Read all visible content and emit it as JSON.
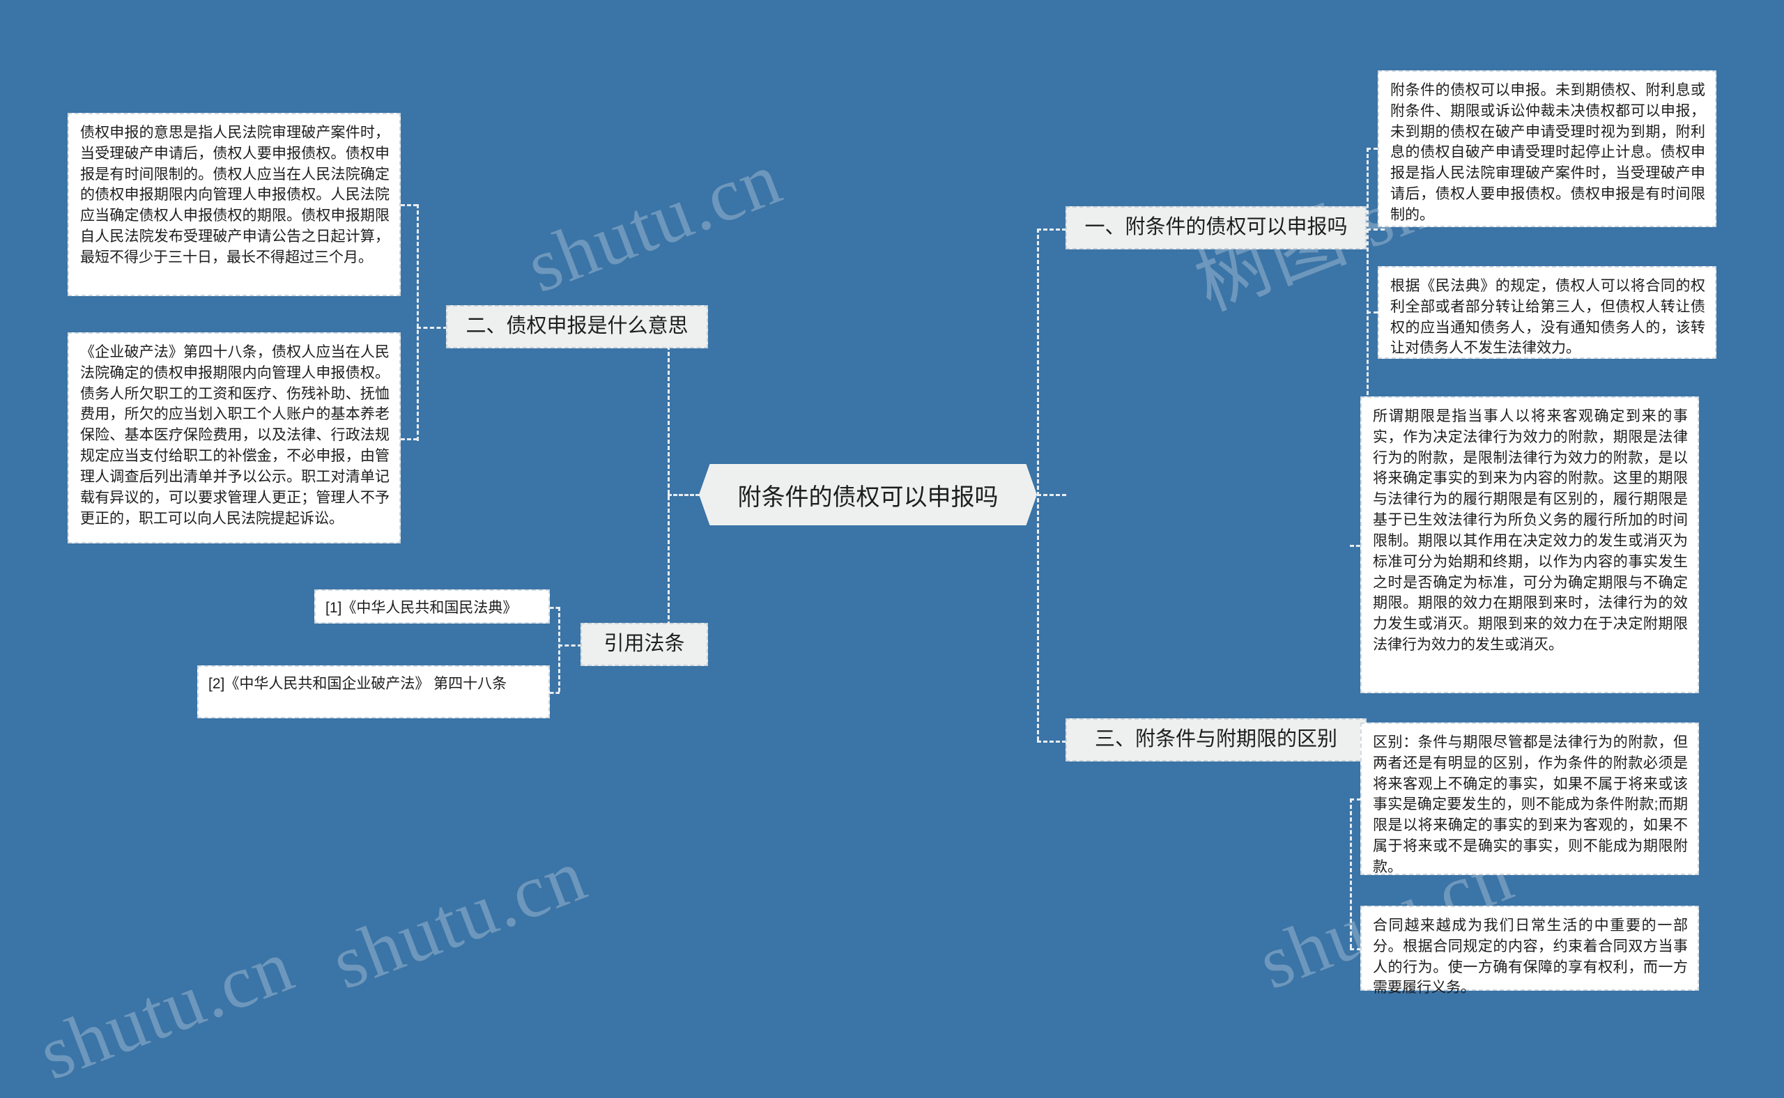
{
  "background_color": "#3b74a6",
  "watermarks": [
    "shutu.cn",
    "树图 shutu.cn",
    "shutu.cn",
    "shutu.cn",
    "shutu.cn"
  ],
  "root": {
    "label": "附条件的债权可以申报吗"
  },
  "branches": {
    "left": [
      {
        "label": "二、债权申报是什么意思",
        "children": [
          "债权申报的意思是指人民法院审理破产案件时，当受理破产申请后，债权人要申报债权。债权申报是有时间限制的。债权人应当在人民法院确定的债权申报期限内向管理人申报债权。人民法院应当确定债权人申报债权的期限。债权申报期限自人民法院发布受理破产申请公告之日起计算，最短不得少于三十日，最长不得超过三个月。",
          "《企业破产法》第四十八条，债权人应当在人民法院确定的债权申报期限内向管理人申报债权。债务人所欠职工的工资和医疗、伤残补助、抚恤费用，所欠的应当划入职工个人账户的基本养老保险、基本医疗保险费用，以及法律、行政法规规定应当支付给职工的补偿金，不必申报，由管理人调查后列出清单并予以公示。职工对清单记载有异议的，可以要求管理人更正；管理人不予更正的，职工可以向人民法院提起诉讼。"
        ]
      },
      {
        "label": "引用法条",
        "children": [
          "[1]《中华人民共和国民法典》",
          "[2]《中华人民共和国企业破产法》 第四十八条"
        ]
      }
    ],
    "right": [
      {
        "label": "一、附条件的债权可以申报吗",
        "children": [
          "附条件的债权可以申报。未到期债权、附利息或附条件、期限或诉讼仲裁未决债权都可以申报，未到期的债权在破产申请受理时视为到期，附利息的债权自破产申请受理时起停止计息。债权申报是指人民法院审理破产案件时，当受理破产申请后，债权人要申报债权。债权申报是有时间限制的。",
          "根据《民法典》的规定，债权人可以将合同的权利全部或者部分转让给第三人，但债权人转让债权的应当通知债务人，没有通知债务人的，该转让对债务人不发生法律效力。",
          "所谓期限是指当事人以将来客观确定到来的事实，作为决定法律行为效力的附款，期限是法律行为的附款，是限制法律行为效力的附款，是以将来确定事实的到来为内容的附款。这里的期限与法律行为的履行期限是有区别的，履行期限是基于已生效法律行为所负义务的履行所加的时间限制。期限以其作用在决定效力的发生或消灭为标准可分为始期和终期，以作为内容的事实发生之时是否确定为标准，可分为确定期限与不确定期限。期限的效力在期限到来时，法律行为的效力发生或消灭。期限到来的效力在于决定附期限法律行为效力的发生或消灭。"
        ]
      },
      {
        "label": "三、附条件与附期限的区别",
        "children": [
          "区别：条件与期限尽管都是法律行为的附款，但两者还是有明显的区别，作为条件的附款必须是将来客观上不确定的事实，如果不属于将来或该事实是确定要发生的，则不能成为条件附款;而期限是以将来确定的事实的到来为客观的，如果不属于将来或不是确实的事实，则不能成为期限附款。",
          "合同越来越成为我们日常生活的中重要的一部分。根据合同规定的内容，约束着合同双方当事人的行为。使一方确有保障的享有权利，而一方需要履行义务。"
        ]
      }
    ]
  }
}
